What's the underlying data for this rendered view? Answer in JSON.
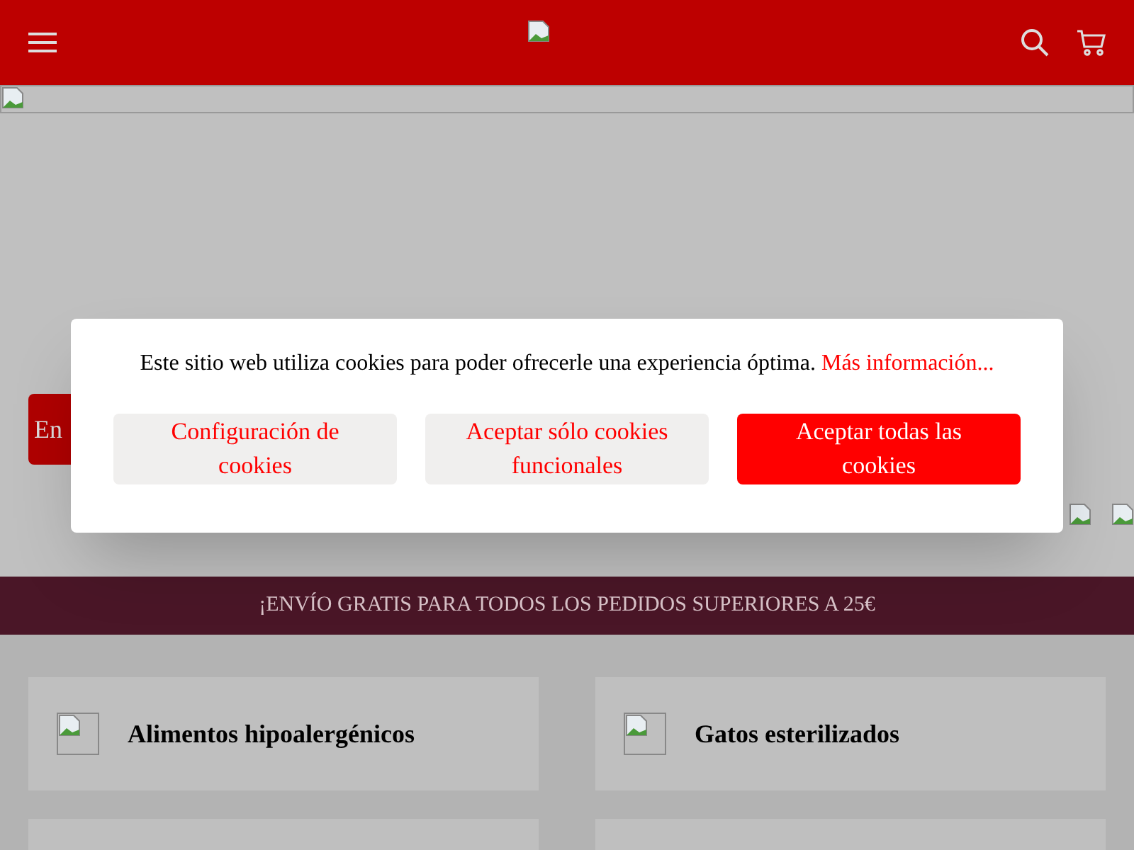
{
  "hero": {
    "button_label": "En"
  },
  "cookie_dialog": {
    "message": "Este sitio web utiliza cookies para poder ofrecerle una experiencia óptima.",
    "link": "Más información...",
    "buttons": [
      {
        "label": "Configuración de cookies",
        "kind": "secondary"
      },
      {
        "label": "Aceptar sólo cookies funcionales",
        "kind": "secondary"
      },
      {
        "label": "Aceptar todas las cookies",
        "kind": "primary"
      }
    ]
  },
  "banner": "¡ENVÍO GRATIS PARA TODOS LOS PEDIDOS SUPERIORES A 25€",
  "categories": [
    {
      "label": "Alimentos hipoalergénicos"
    },
    {
      "label": "Gatos esterilizados"
    }
  ]
}
